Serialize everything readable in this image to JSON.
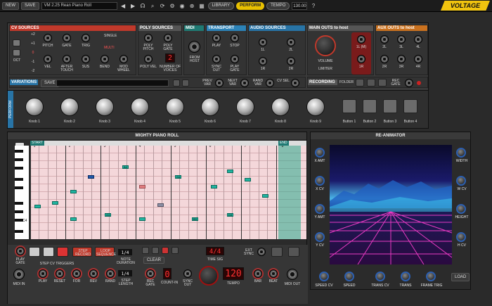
{
  "topbar": {
    "new": "NEW",
    "save": "SAVE",
    "title": "VM 2.25 Rean Piano Roll",
    "library": "LIBRARY",
    "perform": "PERFORM",
    "tempo_label": "TEMPO",
    "tempo_value": "130.00",
    "logo": "VOLTAGE"
  },
  "cv_sources": {
    "title": "CV SOURCES",
    "oct_values": [
      "+2",
      "+1",
      "0",
      "-1",
      "-2"
    ],
    "oct_label": "OCT",
    "single": "SINGLE",
    "multi": "MULTI",
    "row1": [
      "PITCH",
      "GATE",
      "TRIG"
    ],
    "row2": [
      "VEL",
      "AFTER TOUCH",
      "SUS",
      "BEND",
      "MOD WHEEL"
    ]
  },
  "poly_sources": {
    "title": "POLY SOURCES",
    "labels": [
      "POLY PITCH",
      "POLY GATE",
      "POLY VEL",
      "NUMBER OF VOICES"
    ],
    "voices": "2"
  },
  "midi": {
    "title": "MIDI",
    "from_host": "FROM HOST"
  },
  "transport": {
    "title": "TRANSPORT",
    "labels": [
      "PLAY",
      "STOP",
      "SYNC OUT",
      "PLAY GATE"
    ]
  },
  "audio_sources": {
    "title": "AUDIO SOURCES",
    "labels": [
      "1L",
      "2L",
      "1R",
      "2R"
    ]
  },
  "main_outs": {
    "title": "MAIN OUTS to host",
    "volume": "VOLUME",
    "limiter": "LIMITER",
    "labels": [
      "1L (M)",
      "1R"
    ]
  },
  "aux_outs": {
    "title": "AUX OUTS to host",
    "labels": [
      "2L",
      "3L",
      "4L",
      "2R",
      "3R",
      "4R"
    ]
  },
  "variations": {
    "title": "VARIATIONS",
    "save": "SAVE",
    "labels": [
      "PREV VAR",
      "NEXT VAR",
      "RAND VAR",
      "CV SEL"
    ]
  },
  "recording": {
    "title": "RECORDING",
    "folder": "FOLDER",
    "rec_gate": "REC GATE"
  },
  "perform": {
    "tab": "PERFORM",
    "knobs": [
      "Knob 1",
      "Knob 2",
      "Knob 3",
      "Knob 4",
      "Knob 5",
      "Knob 6",
      "Knob 7",
      "Knob 8",
      "Knob 9"
    ],
    "buttons": [
      "Button 1",
      "Button 2",
      "Button 3",
      "Button 4"
    ]
  },
  "piano_roll": {
    "title": "MIGHTY PIANO ROLL",
    "start": "START",
    "end": "END",
    "bars": [
      "1",
      "2",
      "3",
      "4",
      "5",
      "6",
      "7",
      "8"
    ],
    "c_label": "C4",
    "note_labels": [
      "A4",
      "G4",
      "G3",
      "D3",
      "B3"
    ],
    "controls": {
      "play_gate": "PLAY GATE",
      "step_record": "STEP RECORD",
      "loop_sequence": "LOOP SEQUENCE",
      "note_duration_label": "NOTE DURATION",
      "note_duration_value": "1/4",
      "step_length_label": "STEP LENGTH",
      "step_length_value": "1/4",
      "clear": "CLEAR",
      "time_sig": "4/4",
      "time_sig_label": "TIME SIG",
      "ext_sync": "EXT SYNC",
      "step_cv_triggers": "STEP CV TRIGGERS",
      "triggers": [
        "PLAY",
        "RESET",
        "FOR",
        "REV",
        "RAND"
      ],
      "midi_in": "MIDI IN",
      "rec_gate": "REC GATE",
      "count_in": "COUNT-IN",
      "count_in_value": "0",
      "sync_out": "SYNC OUT",
      "tempo": "TEMPO",
      "tempo_value": "120",
      "bar": "BAR",
      "beat": "BEAT",
      "midi_out": "MIDI OUT"
    }
  },
  "re_animator": {
    "title": "RE-ANIMATOR",
    "left": [
      "X AMT",
      "X CV",
      "Y AMT",
      "Y CV"
    ],
    "right": [
      "WIDTH",
      "W CV",
      "HEIGHT",
      "H CV"
    ],
    "bottom": [
      "SPEED CV",
      "SPEED",
      "TRANS CV",
      "TRANS",
      "FRAME TRIG"
    ],
    "load": "LOAD"
  }
}
